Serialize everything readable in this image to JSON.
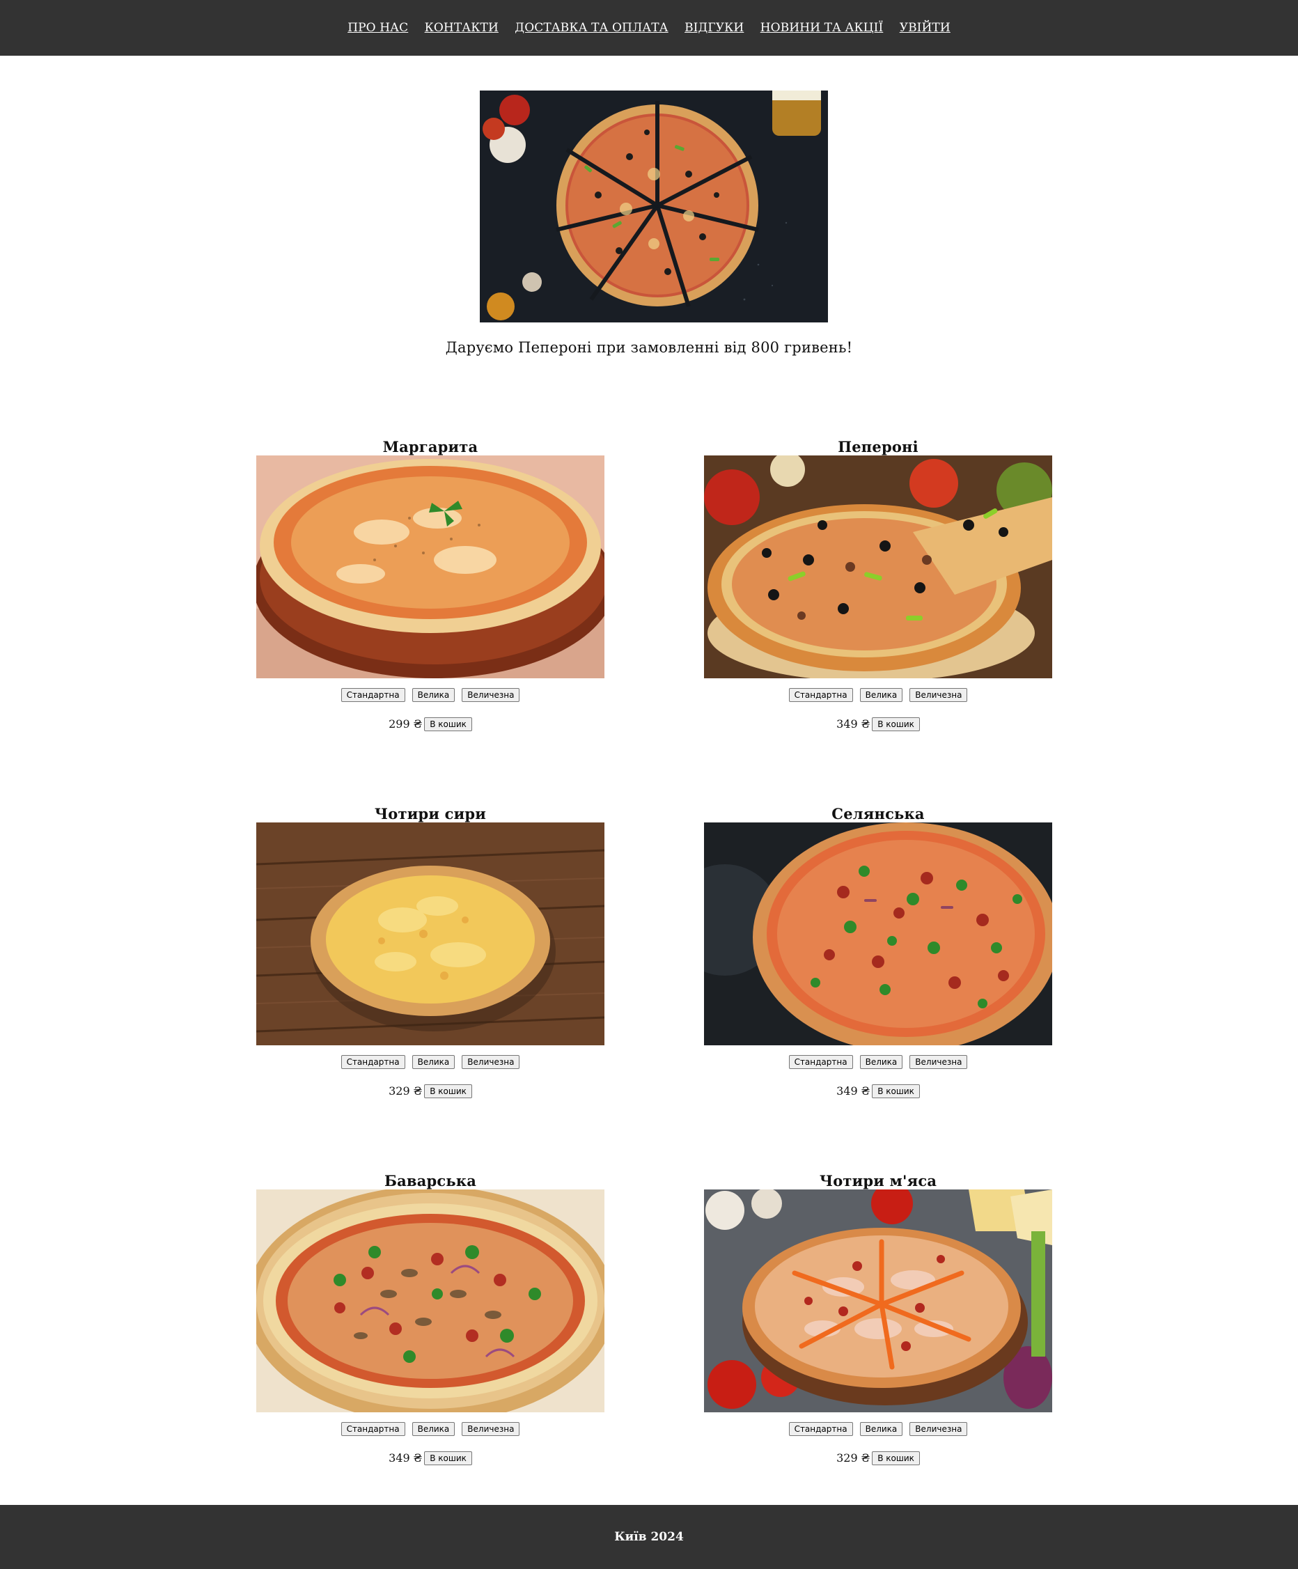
{
  "nav": {
    "items": [
      {
        "label": "ПРО НАС"
      },
      {
        "label": "КОНТАКТИ"
      },
      {
        "label": "ДОСТАВКА ТА ОПЛАТА"
      },
      {
        "label": "ВІДГУКИ"
      },
      {
        "label": "НОВИНИ ТА АКЦІЇ"
      },
      {
        "label": "УВІЙТИ"
      }
    ]
  },
  "promo": {
    "text": "Даруємо Пепероні при замовленні від 800 гривень!"
  },
  "size_options": {
    "standard": "Стандартна",
    "large": "Велика",
    "huge": "Величезна"
  },
  "cart_button_label": "В кошик",
  "products": [
    {
      "name": "Маргарита",
      "price": "299 ₴",
      "image_icon": "pizza-margarita-photo"
    },
    {
      "name": "Пепероні",
      "price": "349 ₴",
      "image_icon": "pizza-pepperoni-photo"
    },
    {
      "name": "Чотири сири",
      "price": "329 ₴",
      "image_icon": "pizza-four-cheese-photo"
    },
    {
      "name": "Селянська",
      "price": "349 ₴",
      "image_icon": "pizza-rustic-photo"
    },
    {
      "name": "Баварська",
      "price": "349 ₴",
      "image_icon": "pizza-bavarian-photo"
    },
    {
      "name": "Чотири м'яса",
      "price": "329 ₴",
      "image_icon": "pizza-four-meat-photo"
    }
  ],
  "footer": {
    "text": "Київ 2024"
  },
  "colors": {
    "header_bg": "#333333",
    "footer_bg": "#333333",
    "page_bg": "#ffffff",
    "nav_text": "#ffffff"
  }
}
